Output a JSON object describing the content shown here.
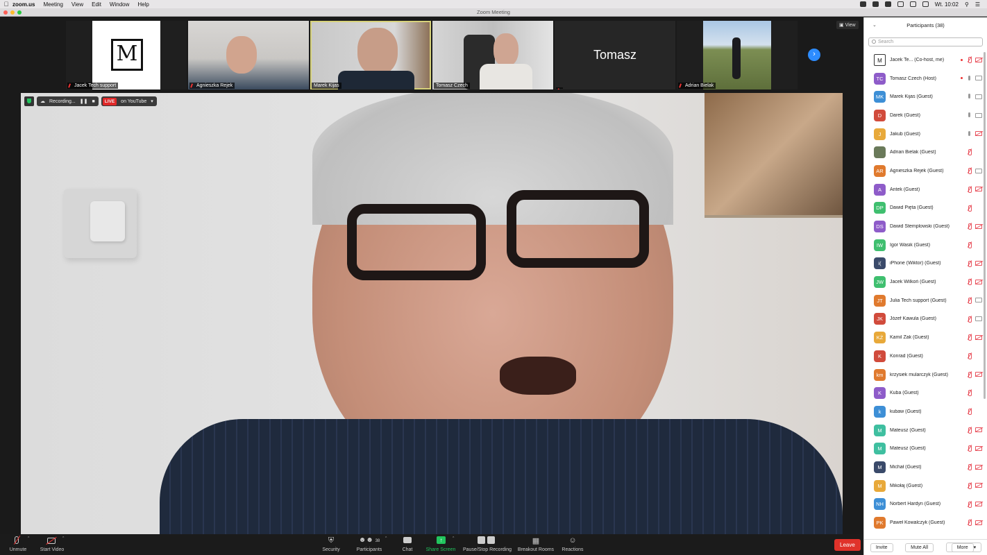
{
  "menubar": {
    "app": "zoom.us",
    "items": [
      "Meeting",
      "View",
      "Edit",
      "Window",
      "Help"
    ],
    "clock": "Wt. 10:02"
  },
  "window": {
    "title": "Zoom Meeting"
  },
  "thumbnails": [
    {
      "name": "Jacek Tech support",
      "type": "logo",
      "logo_text": "M"
    },
    {
      "name": "Agnieszka Rejek",
      "type": "video"
    },
    {
      "name": "Marek Kijas",
      "type": "video",
      "active": true
    },
    {
      "name": "Tomasz Czech",
      "type": "video"
    },
    {
      "name": "",
      "type": "namecard",
      "card_text": "Tomasz"
    },
    {
      "name": "Adrian Bielak",
      "type": "video"
    }
  ],
  "view_button": "View",
  "recording": {
    "status": "Recording...",
    "live": "LIVE",
    "destination": "on YouTube"
  },
  "toolbar": {
    "unmute": "Unmute",
    "start_video": "Start Video",
    "security": "Security",
    "participants": "Participants",
    "participant_count": "38",
    "chat": "Chat",
    "share_screen": "Share Screen",
    "recording": "Pause/Stop Recording",
    "breakout": "Breakout Rooms",
    "reactions": "Reactions",
    "leave": "Leave"
  },
  "panel": {
    "title": "Participants (38)",
    "search_placeholder": "Search",
    "footer": {
      "invite": "Invite",
      "mute_all": "Mute All",
      "more": "More"
    },
    "participants": [
      {
        "initials": "M",
        "name": "Jacek Te... (Co-host, me)",
        "color": "#ffffff",
        "mic": "muted",
        "video": "off",
        "rec": true,
        "logo": true
      },
      {
        "initials": "TC",
        "name": "Tomasz Czech (Host)",
        "color": "#8e5cc9",
        "mic": "on",
        "video": "on",
        "rec": true
      },
      {
        "initials": "MK",
        "name": "Marek Kijas (Guest)",
        "color": "#3d8fd6",
        "mic": "on",
        "video": "on"
      },
      {
        "initials": "D",
        "name": "Darek (Guest)",
        "color": "#d14b3c",
        "mic": "on",
        "video": "on"
      },
      {
        "initials": "J",
        "name": "Jakub (Guest)",
        "color": "#e8a93a",
        "mic": "on",
        "video": "off"
      },
      {
        "initials": "",
        "name": "Adrian Bielak (Guest)",
        "color": "#6a7a5a",
        "mic": "muted",
        "video": "none"
      },
      {
        "initials": "AR",
        "name": "Agnieszka Rejek (Guest)",
        "color": "#e07a2e",
        "mic": "muted",
        "video": "on"
      },
      {
        "initials": "A",
        "name": "Antek (Guest)",
        "color": "#8e5cc9",
        "mic": "muted",
        "video": "off"
      },
      {
        "initials": "DP",
        "name": "Dawid Pięta (Guest)",
        "color": "#3fbf6f",
        "mic": "muted",
        "video": "none"
      },
      {
        "initials": "DS",
        "name": "Dawid Stemplowski (Guest)",
        "color": "#8e5cc9",
        "mic": "muted",
        "video": "off"
      },
      {
        "initials": "IW",
        "name": "Igor Wasik (Guest)",
        "color": "#3fbf6f",
        "mic": "muted",
        "video": "none"
      },
      {
        "initials": "i(",
        "name": "iPhone (Wiktor) (Guest)",
        "color": "#3a4a6a",
        "mic": "muted",
        "video": "off"
      },
      {
        "initials": "JW",
        "name": "Jacek Wilkoń (Guest)",
        "color": "#3fbf6f",
        "mic": "muted",
        "video": "off"
      },
      {
        "initials": "JT",
        "name": "Julia Tech support (Guest)",
        "color": "#e07a2e",
        "mic": "muted",
        "video": "on"
      },
      {
        "initials": "JK",
        "name": "Józef Kawula (Guest)",
        "color": "#d14b3c",
        "mic": "muted",
        "video": "on"
      },
      {
        "initials": "KŻ",
        "name": "Kamil Żak (Guest)",
        "color": "#e8a93a",
        "mic": "muted",
        "video": "off"
      },
      {
        "initials": "K",
        "name": "Konrad (Guest)",
        "color": "#d14b3c",
        "mic": "muted",
        "video": "none"
      },
      {
        "initials": "km",
        "name": "krzysiek mularczyk (Guest)",
        "color": "#e07a2e",
        "mic": "muted",
        "video": "off"
      },
      {
        "initials": "K",
        "name": "Kuba (Guest)",
        "color": "#8e5cc9",
        "mic": "muted",
        "video": "none"
      },
      {
        "initials": "k",
        "name": "kubaw (Guest)",
        "color": "#3d8fd6",
        "mic": "muted",
        "video": "none"
      },
      {
        "initials": "M",
        "name": "Mateusz (Guest)",
        "color": "#3fbfa0",
        "mic": "muted",
        "video": "off"
      },
      {
        "initials": "M",
        "name": "Mateusz (Guest)",
        "color": "#3fbfa0",
        "mic": "muted",
        "video": "off"
      },
      {
        "initials": "M",
        "name": "Michał (Guest)",
        "color": "#3a4a6a",
        "mic": "muted",
        "video": "off"
      },
      {
        "initials": "M",
        "name": "Mikołaj (Guest)",
        "color": "#e8a93a",
        "mic": "muted",
        "video": "off"
      },
      {
        "initials": "NH",
        "name": "Norbert Hardyn (Guest)",
        "color": "#3d8fd6",
        "mic": "muted",
        "video": "off"
      },
      {
        "initials": "PK",
        "name": "Paweł Kowalczyk (Guest)",
        "color": "#e07a2e",
        "mic": "muted",
        "video": "off"
      }
    ]
  }
}
